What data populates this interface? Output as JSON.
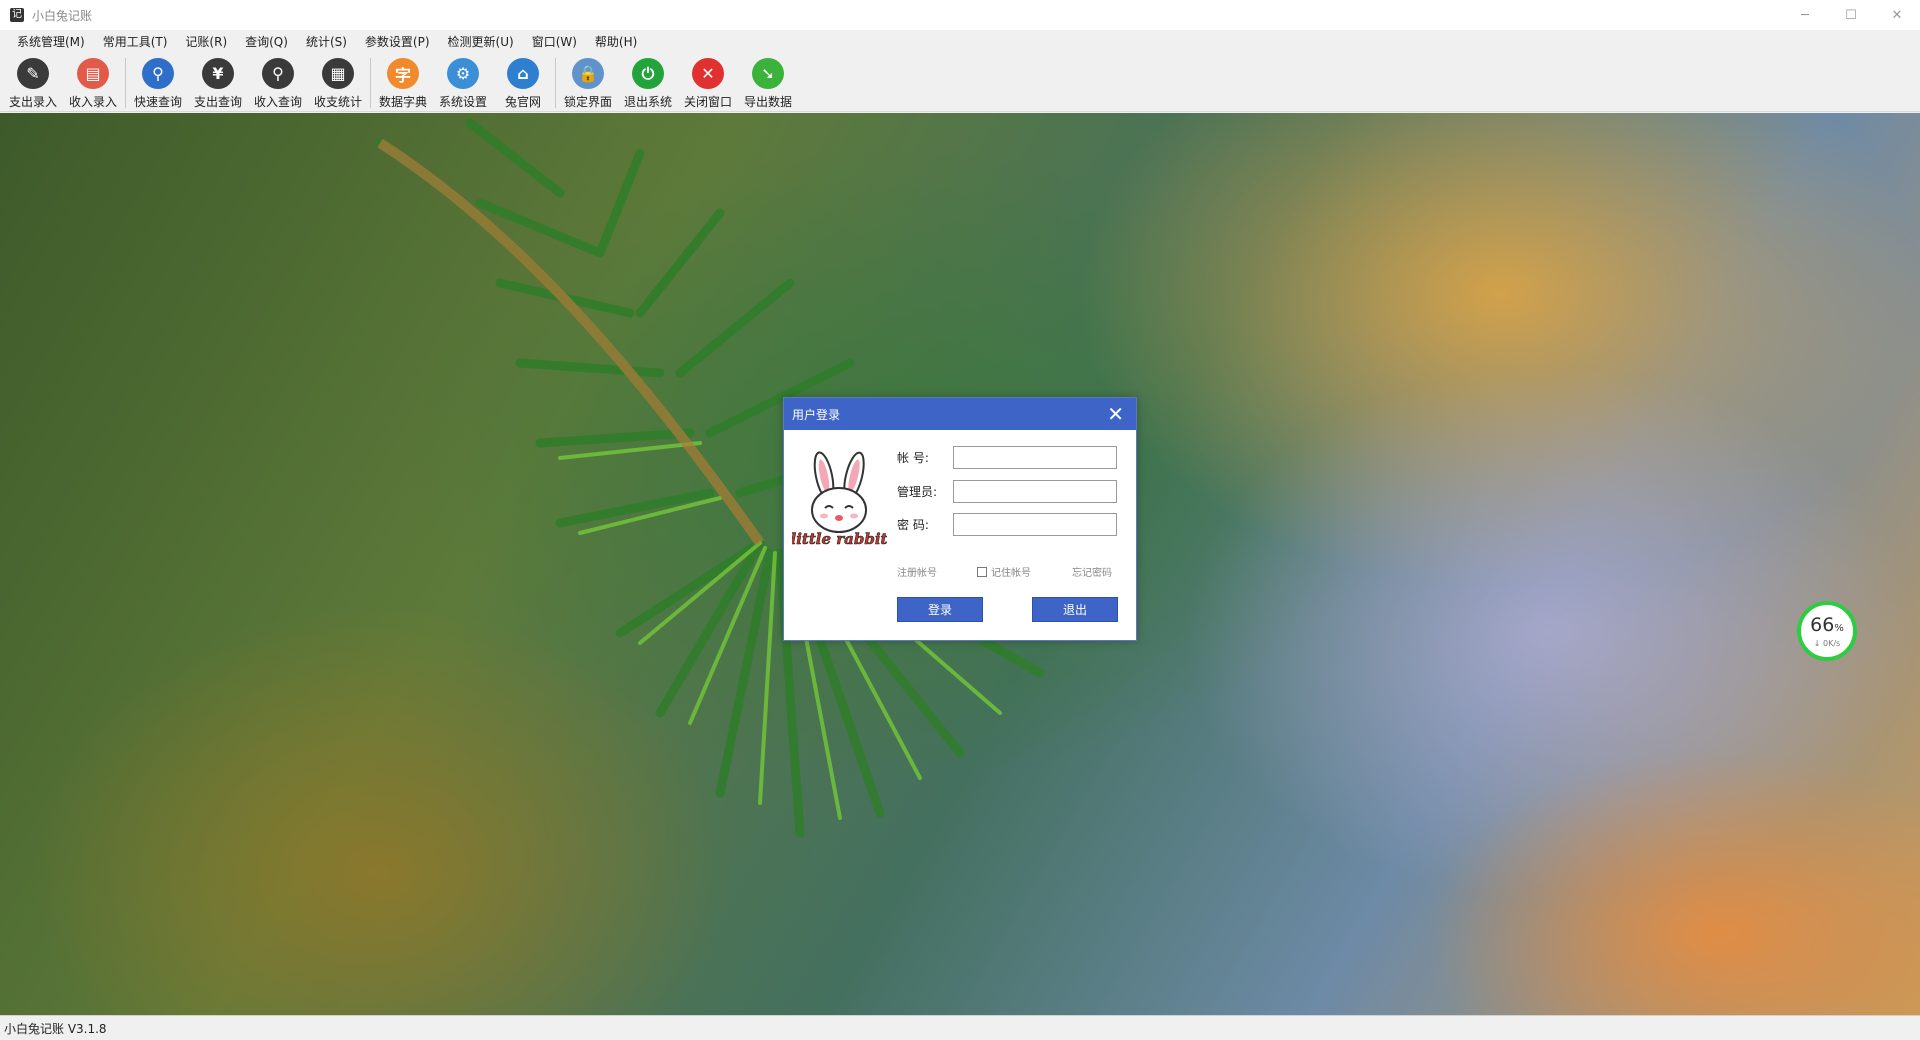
{
  "window": {
    "title": "小白兔记账",
    "app_icon": "记",
    "minimize": "─",
    "maximize": "☐",
    "close": "✕"
  },
  "menu": [
    "系统管理(M)",
    "常用工具(T)",
    "记账(R)",
    "查询(Q)",
    "统计(S)",
    "参数设置(P)",
    "检测更新(U)",
    "窗口(W)",
    "帮助(H)"
  ],
  "toolbar": [
    {
      "label": "支出录入",
      "icon": "expense-entry-icon",
      "color": "#3a3a3a",
      "glyph": "✎"
    },
    {
      "label": "收入录入",
      "icon": "income-entry-icon",
      "color": "#e25b4a",
      "glyph": "▤"
    },
    {
      "label": "快速查询",
      "icon": "quick-search-icon",
      "color": "#2f6fc9",
      "glyph": "⚲"
    },
    {
      "label": "支出查询",
      "icon": "expense-query-icon",
      "color": "#3a3a3a",
      "glyph": "¥"
    },
    {
      "label": "收入查询",
      "icon": "income-query-icon",
      "color": "#3a3a3a",
      "glyph": "⚲"
    },
    {
      "label": "收支统计",
      "icon": "statistics-icon",
      "color": "#3a3a3a",
      "glyph": "▦"
    },
    {
      "label": "数据字典",
      "icon": "data-dictionary-icon",
      "color": "#f08a2c",
      "glyph": "字"
    },
    {
      "label": "系统设置",
      "icon": "settings-icon",
      "color": "#3b8fd6",
      "glyph": "⚙"
    },
    {
      "label": "兔官网",
      "icon": "home-icon",
      "color": "#2f7fd0",
      "glyph": "⌂"
    },
    {
      "label": "锁定界面",
      "icon": "lock-icon",
      "color": "#5f93c9",
      "glyph": "🔒"
    },
    {
      "label": "退出系统",
      "icon": "power-icon",
      "color": "#23a43a",
      "glyph": "⏻"
    },
    {
      "label": "关闭窗口",
      "icon": "close-window-icon",
      "color": "#e03030",
      "glyph": "✕"
    },
    {
      "label": "导出数据",
      "icon": "export-icon",
      "color": "#3bb33b",
      "glyph": "➘"
    }
  ],
  "login": {
    "title": "用户登录",
    "close": "✕",
    "account_label": "帐    号:",
    "account_value": "",
    "admin_label": "管理员:",
    "admin_value": "",
    "password_label": "密    码:",
    "password_value": "",
    "register": "注册帐号",
    "remember": "记住帐号",
    "forgot": "忘记密码",
    "login_btn": "登录",
    "exit_btn": "退出",
    "logo_text": "little rabbit"
  },
  "gauge": {
    "value": "66",
    "unit": "%",
    "speed": "↓ 0K/s"
  },
  "status": {
    "version": "小白兔记账 V3.1.8"
  },
  "colors": {
    "accent": "#3e64c8",
    "gauge": "#2ecc40"
  }
}
